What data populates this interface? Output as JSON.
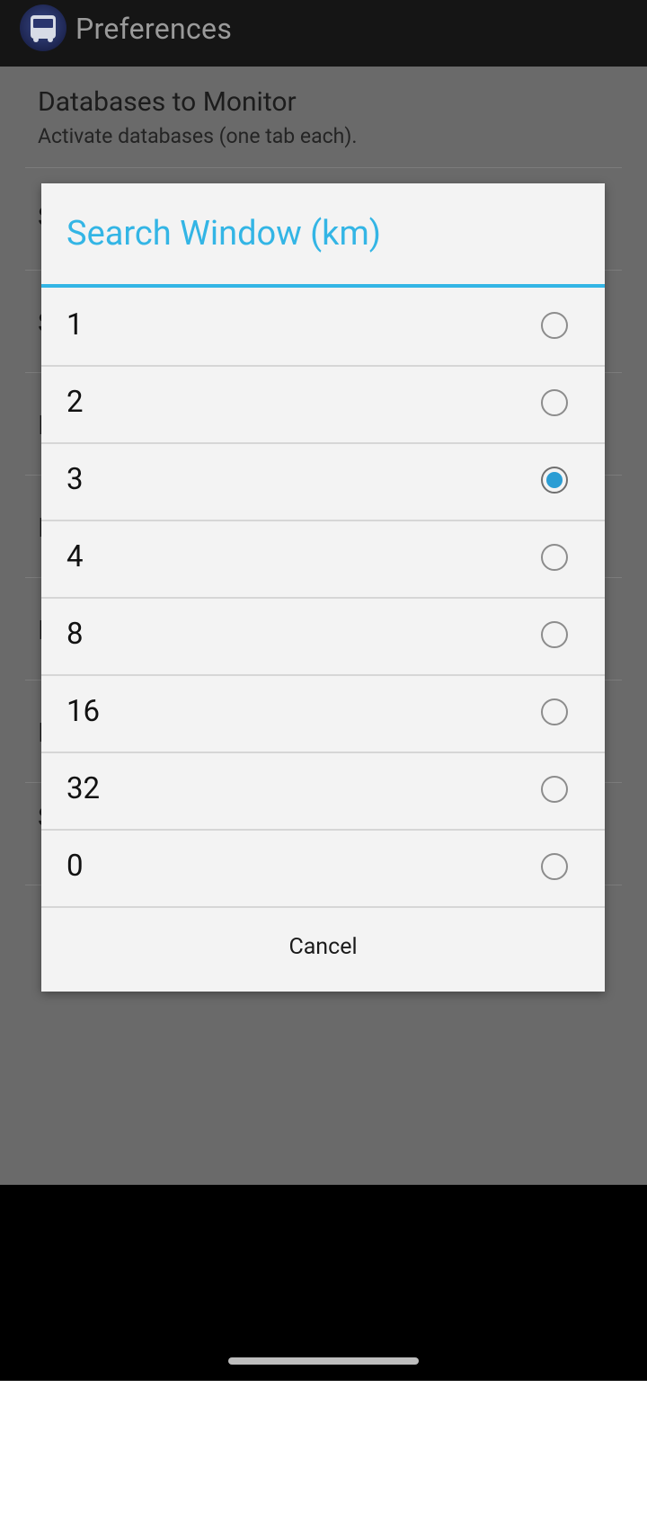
{
  "app": {
    "title": "Preferences",
    "icon": "bus-icon"
  },
  "background": {
    "first_item": {
      "title": "Databases to Monitor",
      "subtitle": "Activate databases (one tab each)."
    },
    "hidden_initials": [
      "S",
      "S",
      "I",
      "I",
      "I",
      "I",
      "S"
    ]
  },
  "dialog": {
    "title": "Search Window (km)",
    "accent_color": "#33b5e5",
    "options": [
      {
        "label": "1",
        "selected": false
      },
      {
        "label": "2",
        "selected": false
      },
      {
        "label": "3",
        "selected": true
      },
      {
        "label": "4",
        "selected": false
      },
      {
        "label": "8",
        "selected": false
      },
      {
        "label": "16",
        "selected": false
      },
      {
        "label": "32",
        "selected": false
      },
      {
        "label": "0",
        "selected": false
      }
    ],
    "cancel_label": "Cancel"
  }
}
